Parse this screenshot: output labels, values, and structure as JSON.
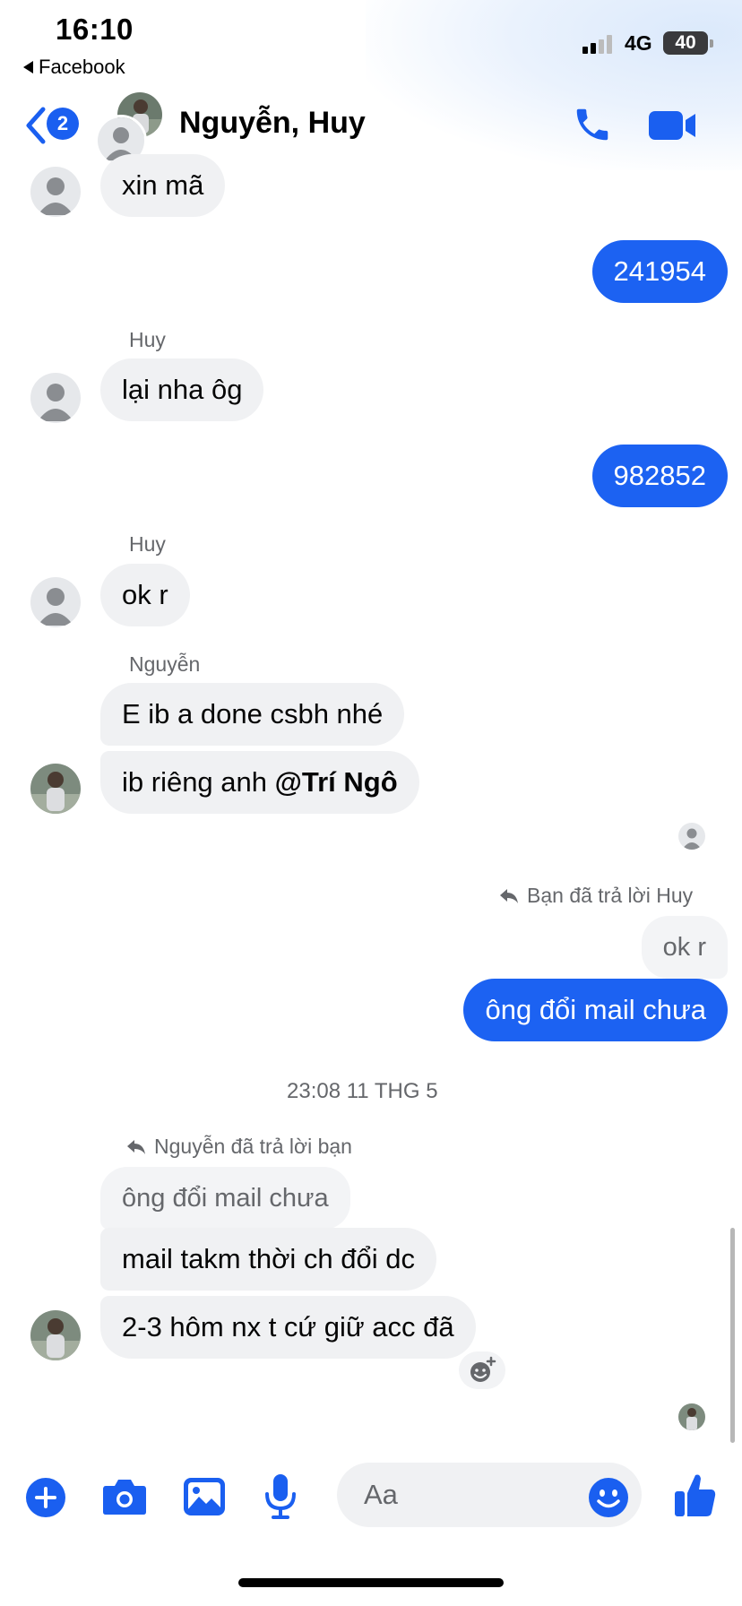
{
  "status": {
    "time": "16:10",
    "back_app": "Facebook",
    "network": "4G",
    "battery": "40"
  },
  "header": {
    "back_badge": "2",
    "title": "Nguyễn, Huy"
  },
  "messages": {
    "m1": "xin mã",
    "m2": "241954",
    "sender_huy_1": "Huy",
    "m3": "lại nha ôg",
    "m4": "982852",
    "sender_huy_2": "Huy",
    "m5": "ok r",
    "sender_nguyen": "Nguyễn",
    "m6": "E ib a done csbh nhé",
    "m7_text": "ib riêng anh ",
    "m7_mention": "@Trí Ngô",
    "reply_note_1": "Bạn đã trả lời Huy",
    "quote_1": "ok r",
    "m8": "ông đổi mail chưa",
    "timestamp": "23:08 11 THG 5",
    "reply_note_2": "Nguyễn đã trả lời bạn",
    "quote_2": "ông đổi mail chưa",
    "m9": "mail takm thời ch đổi dc",
    "m10": "2-3 hôm nx t cứ giữ acc đã"
  },
  "composer": {
    "placeholder": "Aa"
  },
  "colors": {
    "accent": "#1c62f2",
    "incoming_bubble": "#f0f1f3"
  },
  "icons": [
    "chevron-left-icon",
    "phone-icon",
    "video-icon",
    "add-icon",
    "camera-icon",
    "image-icon",
    "microphone-icon",
    "emoji-icon",
    "like-icon",
    "add-reaction-icon",
    "reply-arrow-icon"
  ]
}
